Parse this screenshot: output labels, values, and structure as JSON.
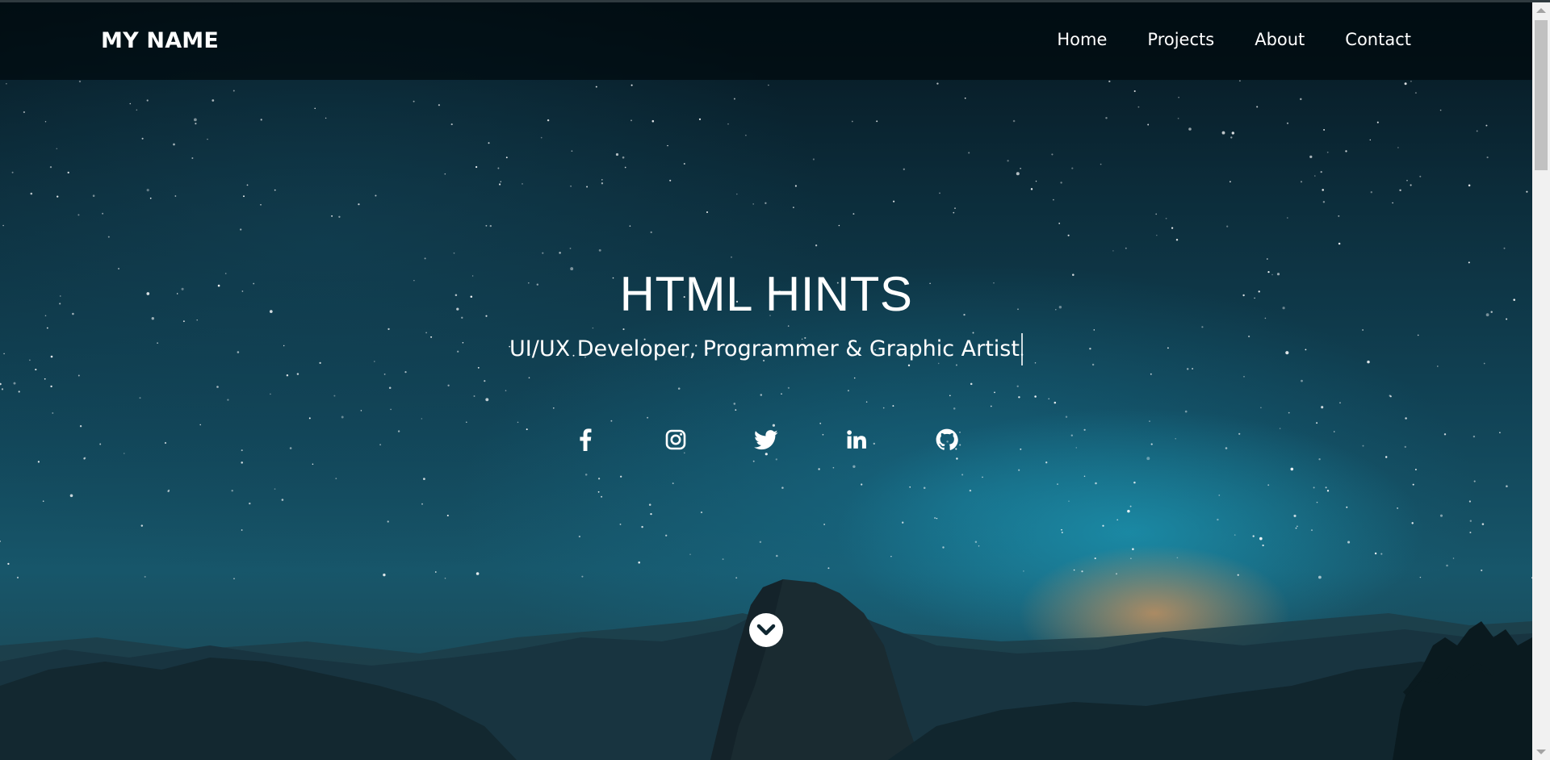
{
  "nav": {
    "brand": "MY NAME",
    "links": [
      {
        "label": "Home"
      },
      {
        "label": "Projects"
      },
      {
        "label": "About"
      },
      {
        "label": "Contact"
      }
    ]
  },
  "hero": {
    "title": "HTML HINTS",
    "subtitle": "UI/UX Developer, Programmer & Graphic Artist"
  },
  "socials": [
    {
      "icon": "facebook-icon"
    },
    {
      "icon": "instagram-icon"
    },
    {
      "icon": "twitter-icon"
    },
    {
      "icon": "linkedin-icon"
    },
    {
      "icon": "github-icon"
    }
  ],
  "scroll_down": {
    "icon": "chevron-down-icon"
  },
  "colors": {
    "nav_background": "#000a0e",
    "text": "#ffffff",
    "scrollbar_track": "#f1f1f1",
    "scrollbar_thumb": "#c1c1c1"
  }
}
